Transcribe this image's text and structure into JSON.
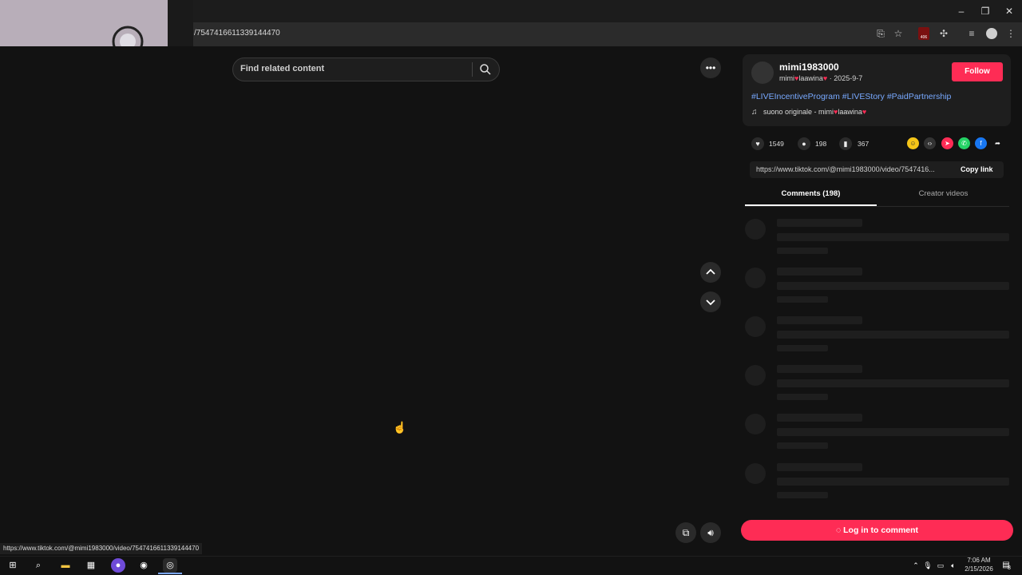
{
  "browser": {
    "url": "/7547416611339144470",
    "extension_badge": "406",
    "status_url": "https://www.tiktok.com/@mimi1983000/video/7547416611339144470"
  },
  "search": {
    "placeholder": "Find related content"
  },
  "profile": {
    "username": "mimi1983000",
    "display_name": "mimi",
    "display_name_suffix": "laawina",
    "date": "· 2025-9-7",
    "follow_label": "Follow",
    "hashtags": "#LIVEIncentiveProgram #LIVEStory #PaidPartnership",
    "music": "suono originale - mimi",
    "music_suffix": "laawina"
  },
  "stats": {
    "likes": "1549",
    "comments": "198",
    "saves": "367"
  },
  "link": {
    "url": "https://www.tiktok.com/@mimi1983000/video/7547416...",
    "copy_label": "Copy link"
  },
  "tabs": {
    "comments": "Comments (198)",
    "creator": "Creator videos"
  },
  "login": {
    "label": "Log in to comment"
  },
  "taskbar": {
    "time": "7:06 AM",
    "date": "2/15/2026",
    "notifications": "8"
  },
  "colors": {
    "accent": "#fe2c55",
    "hashtag": "#78a9ff",
    "background": "#121212"
  },
  "icons": [
    "search-icon",
    "more-icon",
    "chevron-up-icon",
    "chevron-down-icon",
    "heart-icon",
    "comment-icon",
    "bookmark-icon",
    "share-arrow-icon",
    "volume-icon",
    "music-note-icon"
  ]
}
